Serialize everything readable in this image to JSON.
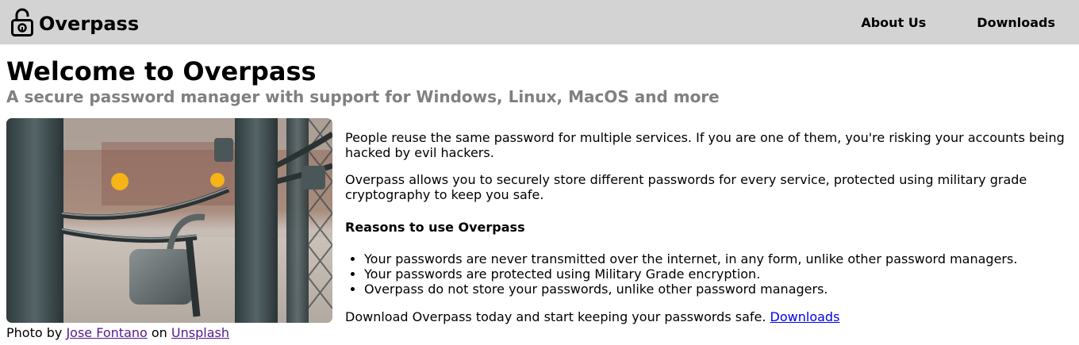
{
  "header": {
    "brand": "Overpass",
    "logo_icon": "padlock-icon",
    "nav": [
      {
        "label": "About Us"
      },
      {
        "label": "Downloads"
      }
    ]
  },
  "hero": {
    "title": "Welcome to Overpass",
    "subtitle": "A secure password manager with support for Windows, Linux, MacOS and more"
  },
  "photo": {
    "alt": "Chained padlock on a metal gate",
    "caption_prefix": "Photo by",
    "author": "Jose Fontano",
    "caption_mid": "on",
    "source": "Unsplash"
  },
  "content": {
    "p1": "People reuse the same password for multiple services. If you are one of them, you're risking your accounts being hacked by evil hackers.",
    "p2": "Overpass allows you to securely store different passwords for every service, protected using military grade cryptography to keep you safe.",
    "reasons_title": "Reasons to use Overpass",
    "reasons": [
      "Your passwords are never transmitted over the internet, in any form, unlike other password managers.",
      "Your passwords are protected using Military Grade encryption.",
      "Overpass do not store your passwords, unlike other password managers."
    ],
    "cta_text": "Download Overpass today and start keeping your passwords safe.",
    "cta_link": "Downloads"
  },
  "colors": {
    "header_bg": "#d3d3d3",
    "subtitle": "#808080",
    "link": "#0000ee",
    "visited_link": "#551a8b"
  }
}
